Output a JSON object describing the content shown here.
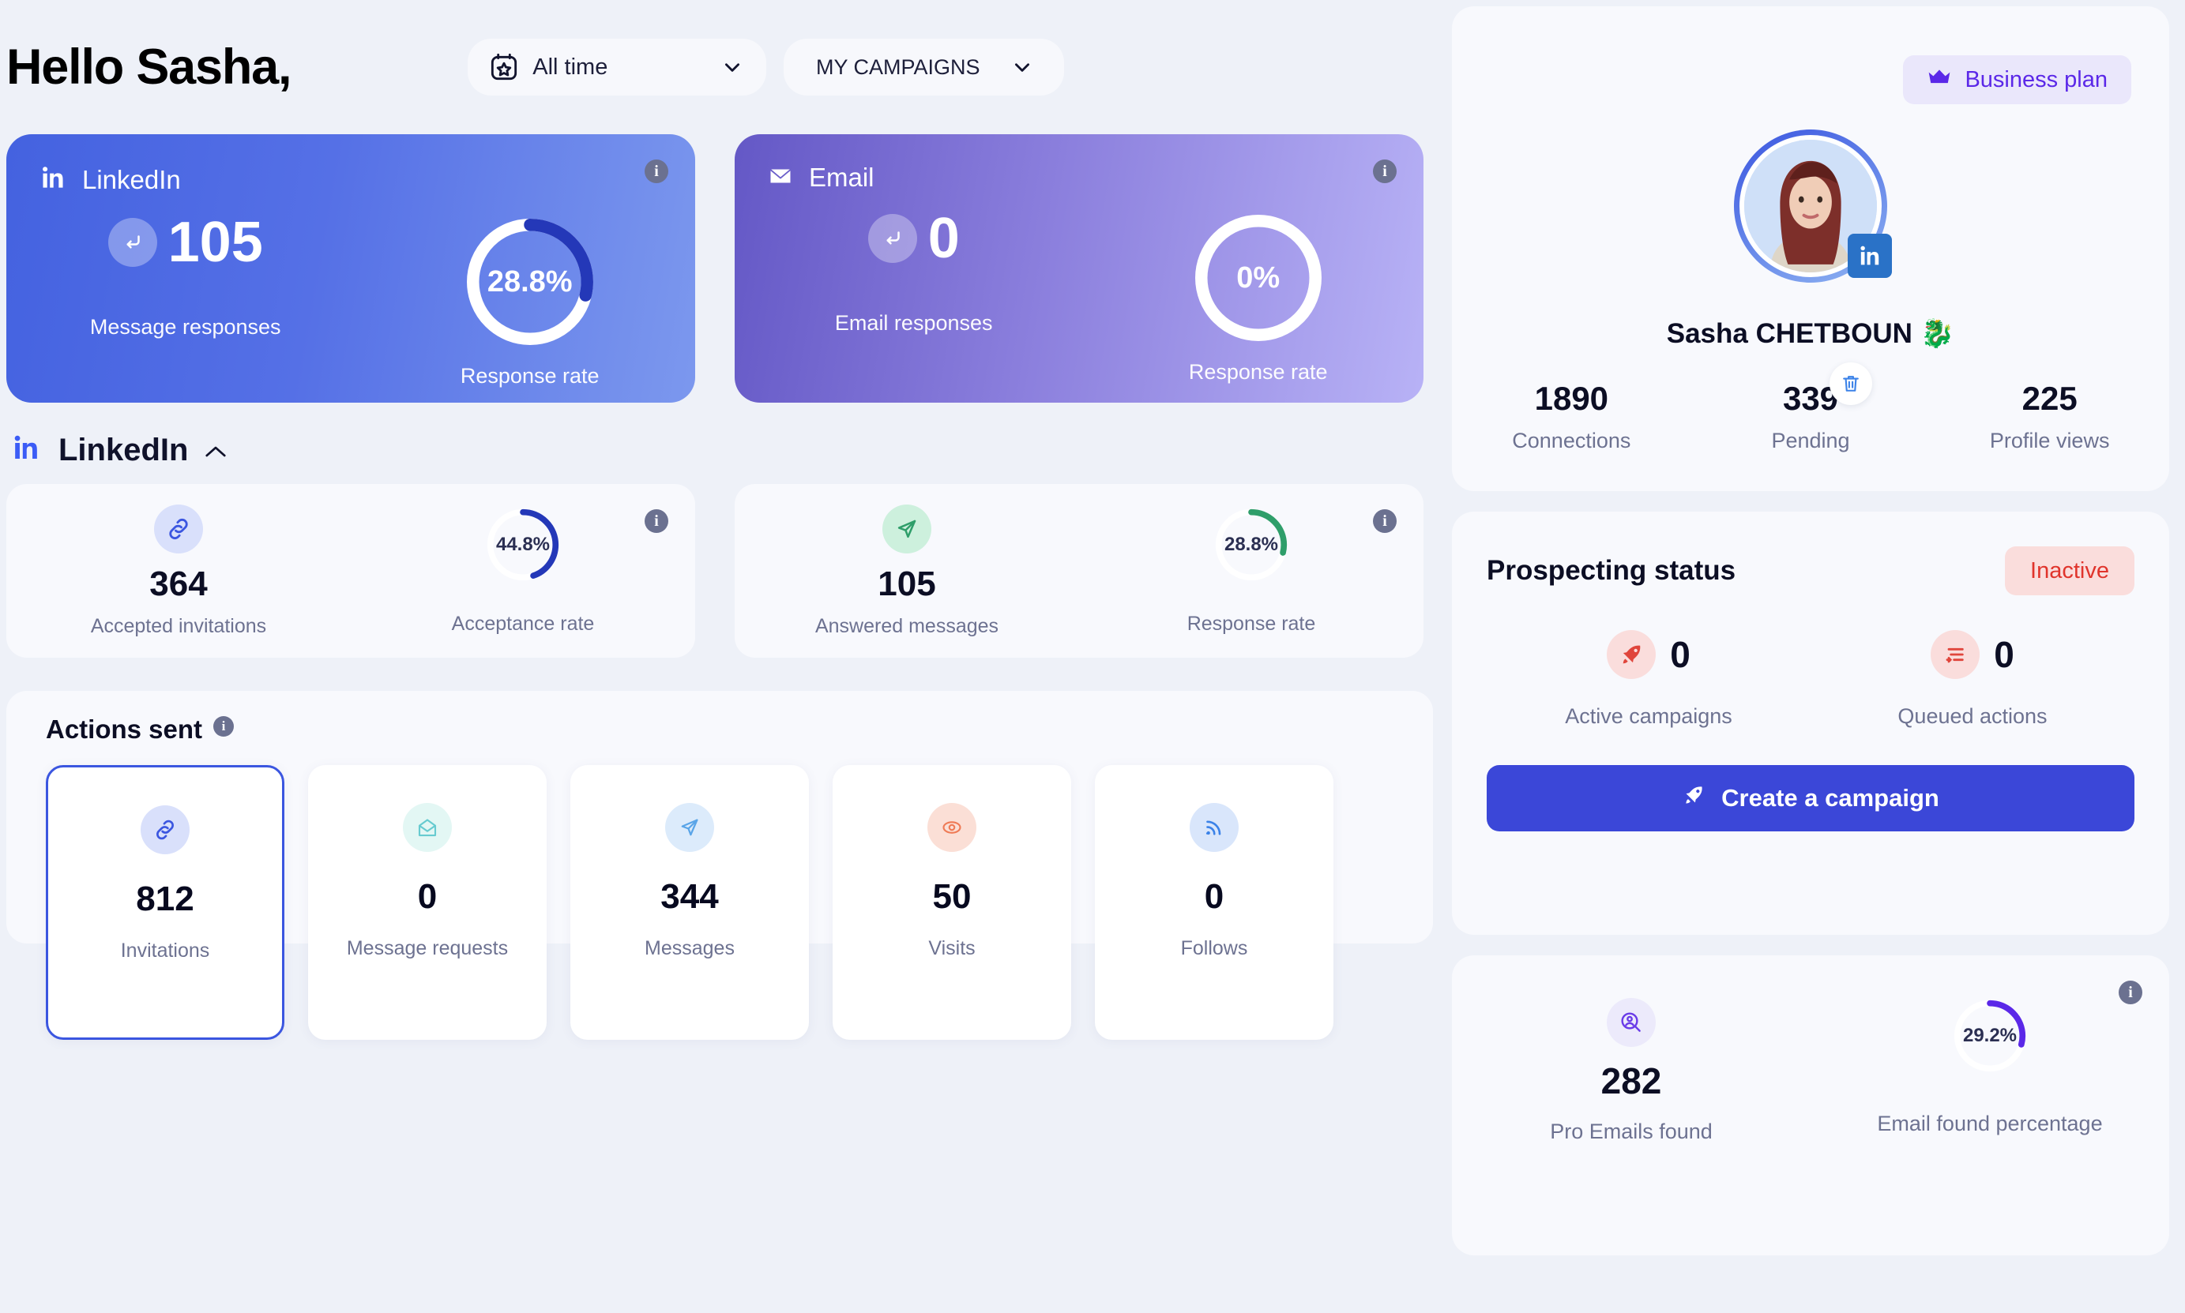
{
  "header": {
    "greeting": "Hello Sasha,",
    "date_filter": {
      "label": "All time",
      "icon": "calendar-star-icon"
    },
    "campaign_filter": {
      "label": "MY CAMPAIGNS"
    }
  },
  "hero_cards": [
    {
      "key": "linkedin",
      "title": "LinkedIn",
      "icon": "linkedin-icon",
      "value": "105",
      "value_label": "Message responses",
      "gauge_value": "28.8%",
      "gauge_pct": 28.8,
      "gauge_label": "Response rate",
      "gradient_from": "#4462e0",
      "gradient_to": "#7c98ee",
      "arc_color": "#2438b8"
    },
    {
      "key": "email",
      "title": "Email",
      "icon": "envelope-icon",
      "value": "0",
      "value_label": "Email responses",
      "gauge_value": "0%",
      "gauge_pct": 0,
      "gauge_label": "Response rate",
      "gradient_from": "#6458c6",
      "gradient_to": "#b8b2f6",
      "arc_color": "#ffffff"
    }
  ],
  "linkedin_section": {
    "title": "LinkedIn",
    "icon": "linkedin-icon",
    "collapse_icon": "chevron-up-icon",
    "cards": [
      {
        "icon": "link-icon",
        "icon_bg": "#d9e0fb",
        "icon_color": "#3b56e0",
        "value": "364",
        "value_label": "Accepted invitations",
        "gauge_value": "44.8%",
        "gauge_pct": 44.8,
        "gauge_label": "Acceptance rate",
        "arc_color": "#2438b8"
      },
      {
        "icon": "send-icon",
        "icon_bg": "#cdf0dd",
        "icon_color": "#2f9e6a",
        "value": "105",
        "value_label": "Answered messages",
        "gauge_value": "28.8%",
        "gauge_pct": 28.8,
        "gauge_label": "Response rate",
        "arc_color": "#2f9e6a"
      }
    ]
  },
  "actions_sent": {
    "title": "Actions sent",
    "info_icon": "info-icon",
    "tiles": [
      {
        "icon": "link-icon",
        "icon_bg": "#d9e0fb",
        "icon_color": "#3b56e0",
        "value": "812",
        "label": "Invitations",
        "selected": true
      },
      {
        "icon": "open-mail-icon",
        "icon_bg": "#e3f7f4",
        "icon_color": "#67cbd0",
        "value": "0",
        "label": "Message requests",
        "selected": false
      },
      {
        "icon": "send-icon",
        "icon_bg": "#dcebfb",
        "icon_color": "#5aa5e8",
        "value": "344",
        "label": "Messages",
        "selected": false
      },
      {
        "icon": "eye-icon",
        "icon_bg": "#fbdfd6",
        "icon_color": "#ef7b56",
        "value": "50",
        "label": "Visits",
        "selected": false
      },
      {
        "icon": "rss-icon",
        "icon_bg": "#d9e6fb",
        "icon_color": "#3b82e8",
        "value": "0",
        "label": "Follows",
        "selected": false
      }
    ]
  },
  "profile": {
    "plan_badge": {
      "label": "Business plan",
      "icon": "crown-icon",
      "color": "#5b28e8"
    },
    "avatar_icon": "avatar",
    "network_badge": "linkedin-icon",
    "name": "Sasha CHETBOUN 🐉",
    "trash_icon": "trash-icon",
    "stats": [
      {
        "value": "1890",
        "label": "Connections"
      },
      {
        "value": "339",
        "label": "Pending"
      },
      {
        "value": "225",
        "label": "Profile views"
      }
    ]
  },
  "prospecting": {
    "title": "Prospecting status",
    "status": {
      "label": "Inactive",
      "color": "#e0342c",
      "bg": "#fadddc"
    },
    "items": [
      {
        "icon": "rocket-icon",
        "icon_bg": "#fadddc",
        "icon_color": "#e0453c",
        "value": "0",
        "label": "Active campaigns"
      },
      {
        "icon": "queue-icon",
        "icon_bg": "#fadddc",
        "icon_color": "#e0453c",
        "value": "0",
        "label": "Queued actions"
      }
    ],
    "cta": {
      "label": "Create a campaign",
      "icon": "rocket-icon",
      "bg": "#3b47d8"
    }
  },
  "pro_emails": {
    "info_icon": "info-icon",
    "icon": "person-search-icon",
    "icon_bg": "#eceafb",
    "icon_color": "#6a3ce8",
    "value": "282",
    "value_label": "Pro Emails found",
    "gauge_value": "29.2%",
    "gauge_pct": 29.2,
    "gauge_label": "Email found percentage",
    "arc_color": "#5b28e8"
  }
}
